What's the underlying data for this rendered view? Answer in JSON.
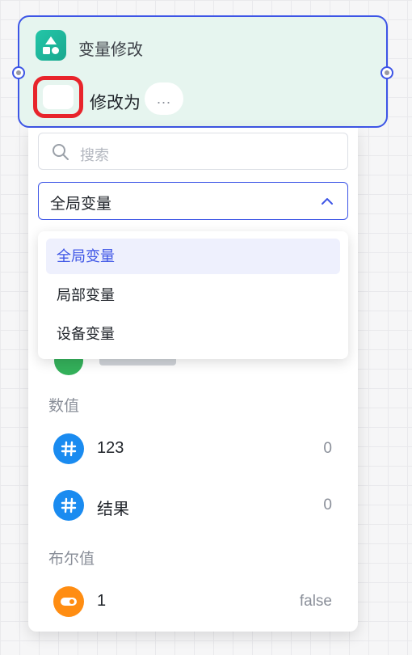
{
  "node": {
    "title": "变量修改",
    "modify_label": "修改为",
    "value_placeholder": "..."
  },
  "search": {
    "placeholder": "搜索"
  },
  "scope_select": {
    "selected": "全局变量",
    "options": [
      "全局变量",
      "局部变量",
      "设备变量"
    ]
  },
  "sections": [
    {
      "label": "数值",
      "items": [
        {
          "name": "123",
          "value": "0",
          "icon": "hash-icon"
        },
        {
          "name": "结果",
          "value": "0",
          "icon": "hash-icon"
        }
      ]
    },
    {
      "label": "布尔值",
      "items": [
        {
          "name": "1",
          "value": "false",
          "icon": "toggle-icon"
        }
      ]
    }
  ],
  "colors": {
    "accent": "#3d55e6",
    "node_bg": "#e6f5ef",
    "highlight_border": "#e8242b",
    "number_icon": "#1a8bf0",
    "boolean_icon": "#ff8d12"
  }
}
